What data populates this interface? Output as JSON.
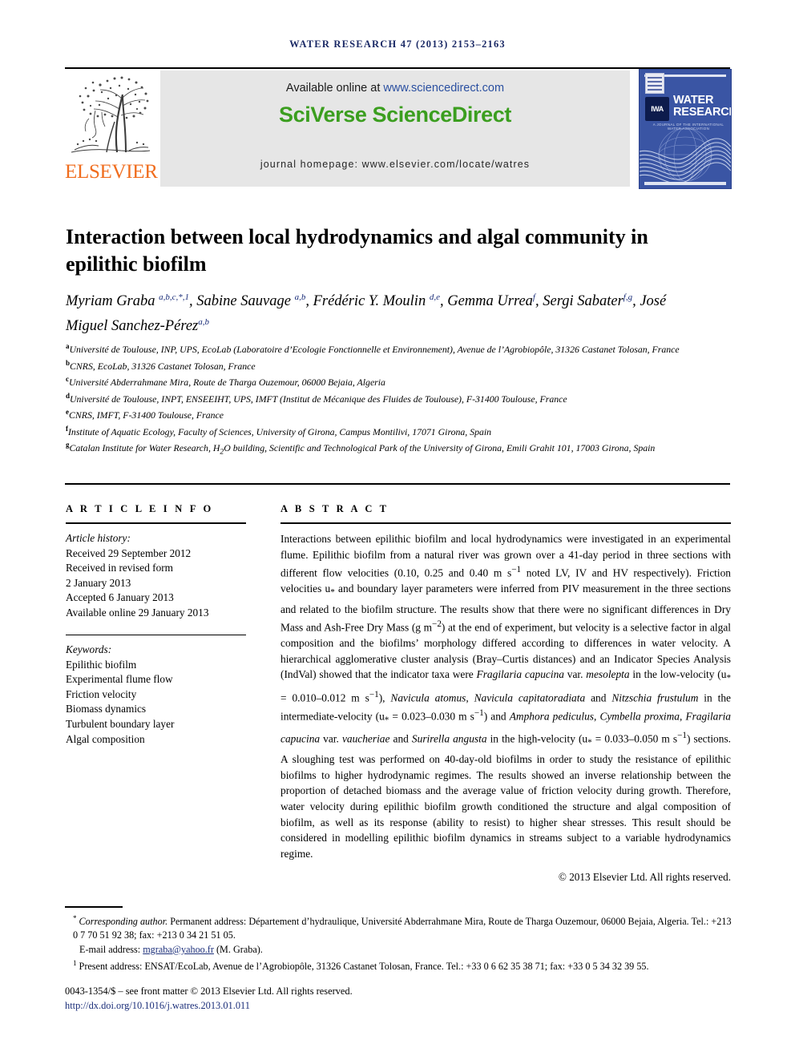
{
  "running_head": "WATER RESEARCH 47 (2013) 2153–2163",
  "masthead": {
    "publisher_name": "ELSEVIER",
    "available_prefix": "Available online at ",
    "available_url": "www.sciencedirect.com",
    "platform_title": "SciVerse ScienceDirect",
    "homepage_line": "journal homepage: www.elsevier.com/locate/watres",
    "cover": {
      "title_line1": "WATER",
      "title_line2": "RESEARCH",
      "badge_text": "IWA",
      "subtitle": "A JOURNAL OF THE INTERNATIONAL WATER ASSOCIATION"
    },
    "colors": {
      "sciencedirect_green": "#3b9e1f",
      "link_blue": "#2a4fa0",
      "elsevier_orange": "#F06D1E",
      "cover_blue": "#3a55a4"
    }
  },
  "article": {
    "title": "Interaction between local hydrodynamics and algal community in epilithic biofilm",
    "authors_html": "Myriam Graba <sup>a,b,c,*,1</sup>, Sabine Sauvage <sup>a,b</sup>, Frédéric Y. Moulin <sup>d,e</sup>, Gemma Urrea<sup>f</sup>, Sergi Sabater<sup>f,g</sup>, José Miguel Sanchez-Pérez<sup>a,b</sup>",
    "affiliations": [
      "<sup>a</sup>Université de Toulouse, INP, UPS, EcoLab (Laboratoire d’Ecologie Fonctionnelle et Environnement), Avenue de l’Agrobiopôle, 31326 Castanet Tolosan, France",
      "<sup>b</sup>CNRS, EcoLab, 31326 Castanet Tolosan, France",
      "<sup>c</sup>Université Abderrahmane Mira, Route de Tharga Ouzemour, 06000 Bejaia, Algeria",
      "<sup>d</sup>Université de Toulouse, INPT, ENSEEIHT, UPS, IMFT (Institut de Mécanique des Fluides de Toulouse), F-31400 Toulouse, France",
      "<sup>e</sup>CNRS, IMFT, F-31400 Toulouse, France",
      "<sup>f</sup>Institute of Aquatic Ecology, Faculty of Sciences, University of Girona, Campus Montilivi, 17071 Girona, Spain",
      "<sup>g</sup>Catalan Institute for Water Research, H<sub>2</sub>O building, Scientific and Technological Park of the University of Girona, Emili Grahit 101, 17003 Girona, Spain"
    ]
  },
  "article_info": {
    "heading": "A R T I C L E   I N F O",
    "history_label": "Article history:",
    "history": [
      "Received 29 September 2012",
      "Received in revised form",
      "2 January 2013",
      "Accepted 6 January 2013",
      "Available online 29 January 2013"
    ],
    "keywords_label": "Keywords:",
    "keywords": [
      "Epilithic biofilm",
      "Experimental flume flow",
      "Friction velocity",
      "Biomass dynamics",
      "Turbulent boundary layer",
      "Algal composition"
    ]
  },
  "abstract": {
    "heading": "A B S T R A C T",
    "body_html": "Interactions between epilithic biofilm and local hydrodynamics were investigated in an experimental flume. Epilithic biofilm from a natural river was grown over a 41-day period in three sections with different flow velocities (0.10, 0.25 and 0.40 m s<sup>−1</sup> noted LV, IV and HV respectively). Friction velocities u<sub>*</sub> and boundary layer parameters were inferred from PIV measurement in the three sections and related to the biofilm structure. The results show that there were no significant differences in Dry Mass and Ash-Free Dry Mass (g m<sup>−2</sup>) at the end of experiment, but velocity is a selective factor in algal composition and the biofilms’ morphology differed according to differences in water velocity. A hierarchical agglomerative cluster analysis (Bray–Curtis distances) and an Indicator Species Analysis (IndVal) showed that the indicator taxa were <i>Fragilaria capucina</i> var. <i>mesolepta</i> in the low-velocity (u<sub>*</sub> = 0.010–0.012 m s<sup>−1</sup>), <i>Navicula atomus</i>, <i>Navicula capitatoradiata</i> and <i>Nitzschia frustulum</i> in the intermediate-velocity (u<sub>*</sub> = 0.023–0.030 m s<sup>−1</sup>) and <i>Amphora pediculus</i>, <i>Cymbella proxima</i>, <i>Fragilaria capucina</i> var. <i>vaucheriae</i> and <i>Surirella angusta</i> in the high-velocity (u<sub>*</sub> = 0.033–0.050 m s<sup>−1</sup>) sections. A sloughing test was performed on 40-day-old biofilms in order to study the resistance of epilithic biofilms to higher hydrodynamic regimes. The results showed an inverse relationship between the proportion of detached biomass and the average value of friction velocity during growth. Therefore, water velocity during epilithic biofilm growth conditioned the structure and algal composition of biofilm, as well as its response (ability to resist) to higher shear stresses. This result should be considered in modelling epilithic biofilm dynamics in streams subject to a variable hydrodynamics regime.",
    "copyright": "© 2013 Elsevier Ltd. All rights reserved."
  },
  "footnotes": {
    "corresponding_html": "<sup>*</sup> <i>Corresponding author.</i> Permanent address: Département d’hydraulique, Université Abderrahmane Mira, Route de Tharga Ouzemour, 06000 Bejaia, Algeria. Tel.: +213 0 7 70 51 92 38; fax: +213 0 34 21 51 05.",
    "email_label": "E-mail address:",
    "email": "mgraba@yahoo.fr",
    "email_suffix": "(M. Graba).",
    "present_address_html": "<sup>1</sup> Present address: ENSAT/EcoLab, Avenue de l’Agrobiopôle, 31326 Castanet Tolosan, France. Tel.: +33 0 6 62 35 38 71; fax: +33 0 5 34 32 39 55."
  },
  "footer": {
    "issn_line": "0043-1354/$ – see front matter © 2013 Elsevier Ltd. All rights reserved.",
    "doi": "http://dx.doi.org/10.1016/j.watres.2013.01.011"
  }
}
